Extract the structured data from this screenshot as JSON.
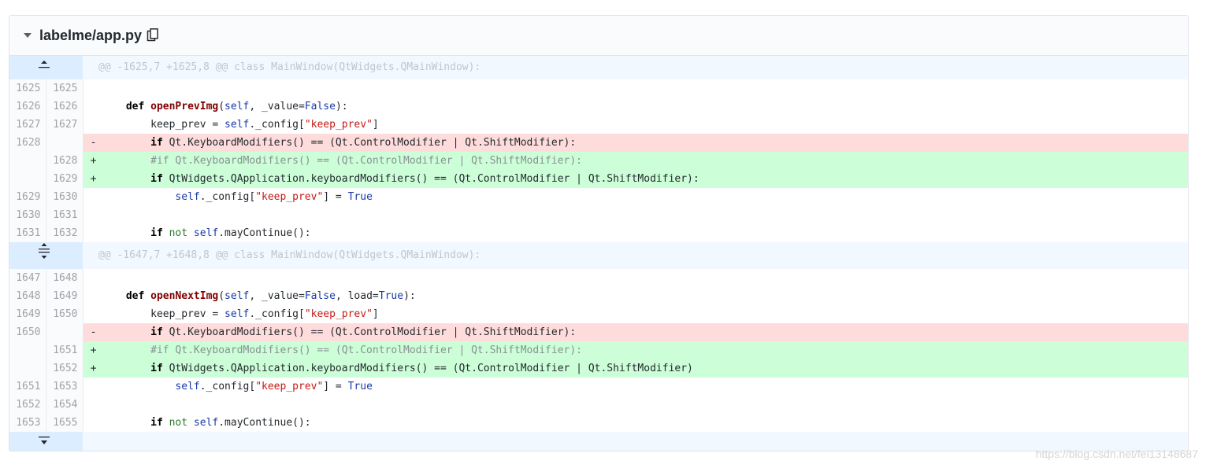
{
  "file": {
    "name": "labelme/app.py",
    "collapse_icon": "triangle-down-icon",
    "copy_icon": "clipboard-copy-icon"
  },
  "hunks": [
    {
      "header": "@@ -1625,7 +1625,8 @@ class MainWindow(QtWidgets.QMainWindow):",
      "expand_icon": "expand-up-icon",
      "lines": [
        {
          "type": "ctx",
          "old": "1625",
          "new": "1625",
          "sign": "",
          "code": ""
        },
        {
          "type": "ctx",
          "old": "1626",
          "new": "1626",
          "sign": "",
          "code": "    def openPrevImg(self, _value=False):"
        },
        {
          "type": "ctx",
          "old": "1627",
          "new": "1627",
          "sign": "",
          "code": "        keep_prev = self._config[\"keep_prev\"]"
        },
        {
          "type": "del",
          "old": "1628",
          "new": "",
          "sign": "-",
          "code": "        if Qt.KeyboardModifiers() == (Qt.ControlModifier | Qt.ShiftModifier):"
        },
        {
          "type": "add",
          "old": "",
          "new": "1628",
          "sign": "+",
          "code": "        #if Qt.KeyboardModifiers() == (Qt.ControlModifier | Qt.ShiftModifier):"
        },
        {
          "type": "add",
          "old": "",
          "new": "1629",
          "sign": "+",
          "code": "        if QtWidgets.QApplication.keyboardModifiers() == (Qt.ControlModifier | Qt.ShiftModifier):"
        },
        {
          "type": "ctx",
          "old": "1629",
          "new": "1630",
          "sign": "",
          "code": "            self._config[\"keep_prev\"] = True"
        },
        {
          "type": "ctx",
          "old": "1630",
          "new": "1631",
          "sign": "",
          "code": ""
        },
        {
          "type": "ctx",
          "old": "1631",
          "new": "1632",
          "sign": "",
          "code": "        if not self.mayContinue():"
        }
      ]
    },
    {
      "header": "@@ -1647,7 +1648,8 @@ class MainWindow(QtWidgets.QMainWindow):",
      "expand_icon": "expand-both-icon",
      "lines": [
        {
          "type": "ctx",
          "old": "1647",
          "new": "1648",
          "sign": "",
          "code": ""
        },
        {
          "type": "ctx",
          "old": "1648",
          "new": "1649",
          "sign": "",
          "code": "    def openNextImg(self, _value=False, load=True):"
        },
        {
          "type": "ctx",
          "old": "1649",
          "new": "1650",
          "sign": "",
          "code": "        keep_prev = self._config[\"keep_prev\"]"
        },
        {
          "type": "del",
          "old": "1650",
          "new": "",
          "sign": "-",
          "code": "        if Qt.KeyboardModifiers() == (Qt.ControlModifier | Qt.ShiftModifier):"
        },
        {
          "type": "add",
          "old": "",
          "new": "1651",
          "sign": "+",
          "code": "        #if Qt.KeyboardModifiers() == (Qt.ControlModifier | Qt.ShiftModifier):"
        },
        {
          "type": "add",
          "old": "",
          "new": "1652",
          "sign": "+",
          "code": "        if QtWidgets.QApplication.keyboardModifiers() == (Qt.ControlModifier | Qt.ShiftModifier)"
        },
        {
          "type": "ctx",
          "old": "1651",
          "new": "1653",
          "sign": "",
          "code": "            self._config[\"keep_prev\"] = True"
        },
        {
          "type": "ctx",
          "old": "1652",
          "new": "1654",
          "sign": "",
          "code": ""
        },
        {
          "type": "ctx",
          "old": "1653",
          "new": "1655",
          "sign": "",
          "code": "        if not self.mayContinue():"
        }
      ]
    }
  ],
  "footer_expand_icon": "expand-down-icon",
  "watermark": "https://blog.csdn.net/fei13148687",
  "colors": {
    "deleted_line": "#ffdcdc",
    "added_line": "#ccffd8",
    "hunk_header": "#f1f8ff",
    "expander": "#dbedff"
  }
}
